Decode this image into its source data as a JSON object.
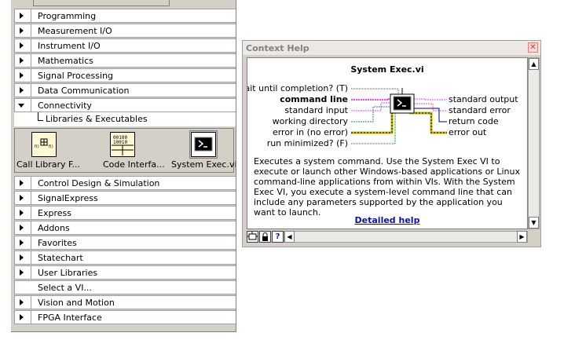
{
  "palette": {
    "categories": [
      {
        "label": "Programming",
        "state": "collapsed"
      },
      {
        "label": "Measurement I/O",
        "state": "collapsed"
      },
      {
        "label": "Instrument I/O",
        "state": "collapsed"
      },
      {
        "label": "Mathematics",
        "state": "collapsed"
      },
      {
        "label": "Signal Processing",
        "state": "collapsed"
      },
      {
        "label": "Data Communication",
        "state": "collapsed"
      },
      {
        "label": "Connectivity",
        "state": "expanded"
      }
    ],
    "subcategory": "Libraries & Executables",
    "vis": [
      {
        "label": "Call Library F...",
        "icon": "call-library-icon"
      },
      {
        "label": "Code Interfa...",
        "icon": "code-interface-icon",
        "icon_text": [
          "00100",
          "10010"
        ]
      },
      {
        "label": "System Exec.vi",
        "icon": "system-exec-icon"
      }
    ],
    "categories_after": [
      {
        "label": "Control Design & Simulation",
        "state": "collapsed"
      },
      {
        "label": "SignalExpress",
        "state": "collapsed"
      },
      {
        "label": "Express",
        "state": "collapsed"
      },
      {
        "label": "Addons",
        "state": "collapsed"
      },
      {
        "label": "Favorites",
        "state": "collapsed"
      },
      {
        "label": "Statechart",
        "state": "collapsed"
      },
      {
        "label": "User Libraries",
        "state": "collapsed"
      },
      {
        "label": "Select a VI...",
        "state": "none"
      },
      {
        "label": "Vision and Motion",
        "state": "collapsed"
      },
      {
        "label": "FPGA Interface",
        "state": "collapsed"
      }
    ]
  },
  "help": {
    "window_title": "Context Help",
    "vi_name": "System Exec.vi",
    "inputs": [
      {
        "label": "wait until completion? (T)",
        "bold": false
      },
      {
        "label": "command line",
        "bold": true
      },
      {
        "label": "standard input",
        "bold": false
      },
      {
        "label": "working directory",
        "bold": false
      },
      {
        "label": "error in (no error)",
        "bold": false
      },
      {
        "label": "run minimized? (F)",
        "bold": false
      }
    ],
    "outputs": [
      {
        "label": "standard output"
      },
      {
        "label": "standard error"
      },
      {
        "label": "return code"
      },
      {
        "label": "error out"
      }
    ],
    "description": "Executes a system command. Use the System Exec VI to execute or launch other Windows-based applications or Linux command-line applications from within VIs. With the System Exec VI, you execute a system-level command line that can include any parameters supported by the application you want to launch.",
    "detailed_help_link": "Detailed help",
    "toolbar": {
      "show_optional_icon": "show-optional-terminals-icon",
      "lock_icon": "lock-icon",
      "help_label": "?"
    },
    "colors": {
      "string_wire": "#ff40ff",
      "error_wire": "#c8b400",
      "path_wire": "#208080",
      "bool_wire": "#008000"
    }
  }
}
